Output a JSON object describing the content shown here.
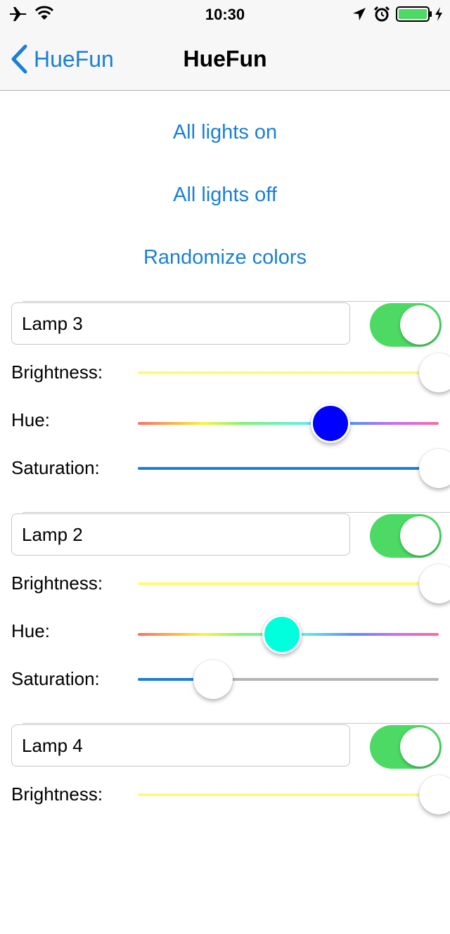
{
  "status_bar": {
    "time": "10:30",
    "icons": [
      "airplane-icon",
      "wifi-icon",
      "location-arrow-icon",
      "alarm-icon",
      "battery-icon",
      "charging-bolt-icon"
    ],
    "battery_color": "#4cd964"
  },
  "nav": {
    "back_label": "HueFun",
    "title": "HueFun",
    "accent": "#1a7fd8"
  },
  "actions": {
    "all_on": "All lights on",
    "all_off": "All lights off",
    "randomize": "Randomize colors"
  },
  "labels": {
    "brightness": "Brightness:",
    "hue": "Hue:",
    "saturation": "Saturation:"
  },
  "lamps": [
    {
      "name": "Lamp 3",
      "on": true,
      "brightness": 1.0,
      "hue": 0.64,
      "saturation": 1.0,
      "color": "#0000ff"
    },
    {
      "name": "Lamp 2",
      "on": true,
      "brightness": 1.0,
      "hue": 0.48,
      "saturation": 0.25,
      "color": "#00ffdd"
    },
    {
      "name": "Lamp 4",
      "on": true,
      "brightness": 1.0
    }
  ],
  "colors": {
    "toggle_on": "#4cd964",
    "saturation_fill": "#1a7fd8",
    "saturation_empty": "#b5b5b5",
    "brightness_track": "#fffb7a"
  }
}
